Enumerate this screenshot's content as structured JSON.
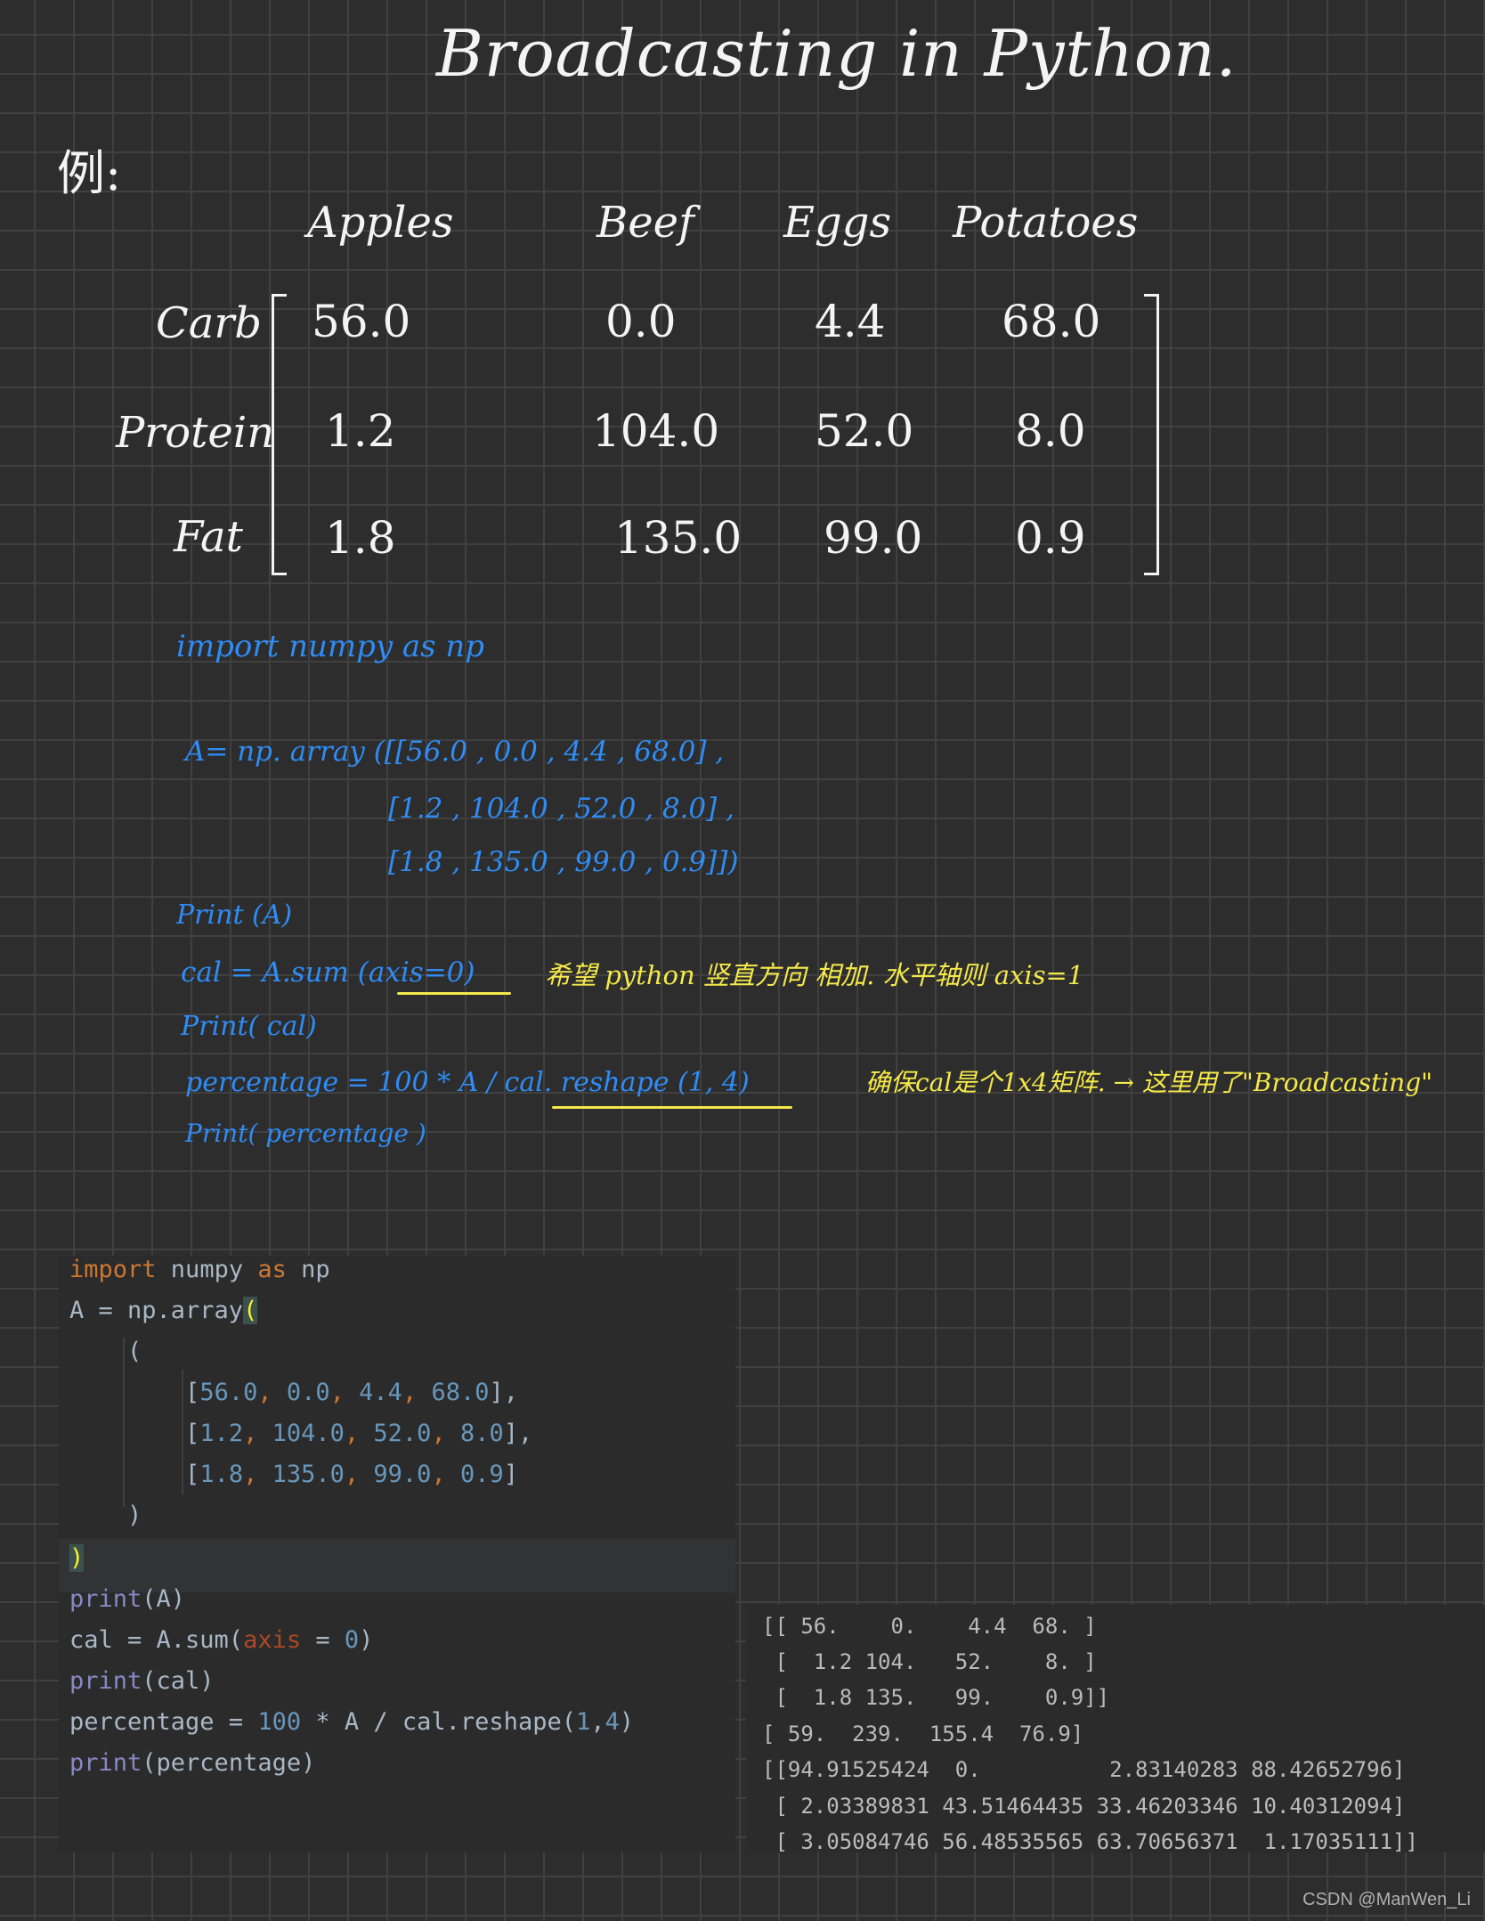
{
  "title": "Broadcasting in Python.",
  "example_label": "例:",
  "matrix": {
    "columns": [
      "Apples",
      "Beef",
      "Eggs",
      "Potatoes"
    ],
    "rows": [
      {
        "label": "Carb",
        "values": [
          "56.0",
          "0.0",
          "4.4",
          "68.0"
        ]
      },
      {
        "label": "Protein",
        "values": [
          "1.2",
          "104.0",
          "52.0",
          "8.0"
        ]
      },
      {
        "label": "Fat",
        "values": [
          "1.8",
          "135.0",
          "99.0",
          "0.9"
        ]
      }
    ]
  },
  "handwritten_code": {
    "import_line": "import numpy as np",
    "array_line1": "A= np. array ([[56.0 , 0.0 , 4.4 , 68.0] ,",
    "array_line2": "[1.2 , 104.0 , 52.0 , 8.0] ,",
    "array_line3": "[1.8 , 135.0 , 99.0 , 0.9]])",
    "print_a": "Print (A)",
    "cal_line": "cal = A.sum (axis=0)",
    "cal_note": "希望 python 竖直方向 相加. 水平轴则 axis=1",
    "percentage_line": "percentage = 100 * A / cal. reshape (1, 4)",
    "percentage_note": "确保cal是个1x4矩阵. → 这里用了\"Broadcasting\"",
    "print_percentage": "Print( percentage )"
  },
  "ide_code": {
    "line1": {
      "kw1": "import",
      "mid": " numpy ",
      "kw2": "as",
      "end": " np"
    },
    "line2": {
      "text": "A = np.array",
      "paren": "("
    },
    "line3": "    (",
    "row1": {
      "open": "        [",
      "n1": "56.0",
      "n2": "0.0",
      "n3": "4.4",
      "n4": "68.0",
      "close": "],"
    },
    "row2": {
      "open": "        [",
      "n1": "1.2",
      "n2": "104.0",
      "n3": "52.0",
      "n4": "8.0",
      "close": "],"
    },
    "row3": {
      "open": "        [",
      "n1": "1.8",
      "n2": "135.0",
      "n3": "99.0",
      "n4": "0.9",
      "close": "]"
    },
    "line7": "    )",
    "line8": ")",
    "line9": {
      "fn": "print",
      "rest": "(A)"
    },
    "line10": {
      "start": "cal = A.sum(",
      "param": "axis",
      "eq": " = ",
      "num": "0",
      "end": ")"
    },
    "line11": {
      "fn": "print",
      "rest": "(cal)"
    },
    "line12": {
      "start": "percentage = ",
      "num1": "100",
      "mid": " * A / cal.reshape(",
      "num2": "1",
      "sep": ",",
      "num3": "4",
      "end": ")"
    },
    "line13": {
      "fn": "print",
      "rest": "(percentage)"
    }
  },
  "output_lines": [
    "[[ 56.    0.    4.4  68. ]",
    " [  1.2 104.   52.    8. ]",
    " [  1.8 135.   99.    0.9]]",
    "[ 59.  239.  155.4  76.9]",
    "[[94.91525424  0.          2.83140283 88.42652796]",
    " [ 2.03389831 43.51464435 33.46203346 10.40312094]",
    " [ 3.05084746 56.48535565 63.70656371  1.17035111]]"
  ],
  "watermark": "CSDN @ManWen_Li",
  "colors": {
    "background": "#2d2d2d",
    "grid": "#404040",
    "handwriting_white": "#f4f4f4",
    "handwriting_blue": "#2f8cf5",
    "handwriting_yellow": "#f5e94a",
    "ide_background": "#2b2b2b",
    "ide_keyword": "#cc7832",
    "ide_number": "#6897bb"
  }
}
